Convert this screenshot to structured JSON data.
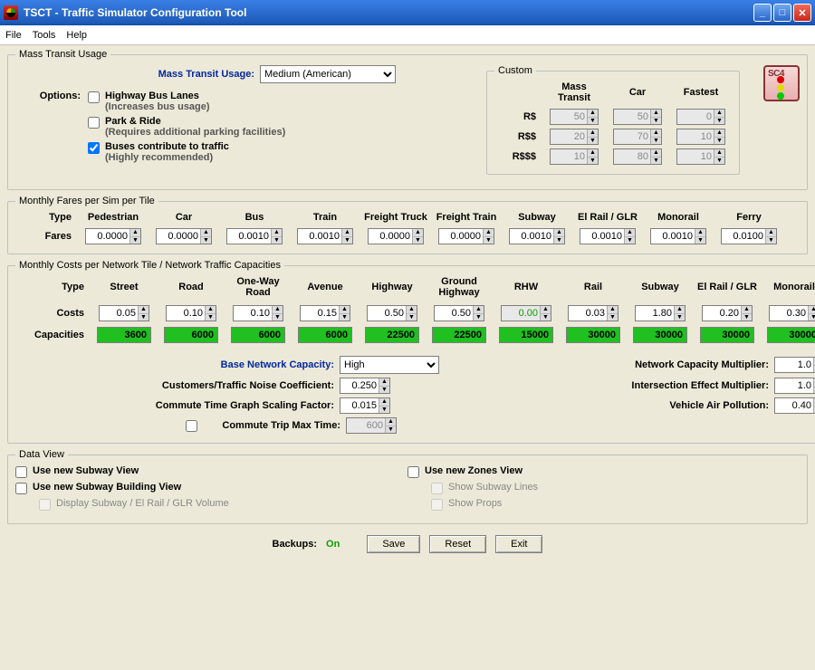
{
  "window_title": "TSCT - Traffic Simulator Configuration Tool",
  "menu": {
    "file": "File",
    "tools": "Tools",
    "help": "Help"
  },
  "mtu": {
    "legend": "Mass Transit Usage",
    "label": "Mass Transit Usage:",
    "value": "Medium (American)",
    "options_label": "Options:",
    "opt1_label": "Highway Bus Lanes",
    "opt1_hint": "(Increases bus usage)",
    "opt2_label": "Park & Ride",
    "opt2_hint": "(Requires additional parking facilities)",
    "opt3_label": "Buses contribute to traffic",
    "opt3_hint": "(Highly recommended)",
    "opt3_checked": true,
    "custom": {
      "legend": "Custom",
      "h_mt": "Mass Transit",
      "h_car": "Car",
      "h_fast": "Fastest",
      "r1": "R$",
      "r1_mt": "50",
      "r1_car": "50",
      "r1_fast": "0",
      "r2": "R$$",
      "r2_mt": "20",
      "r2_car": "70",
      "r2_fast": "10",
      "r3": "R$$$",
      "r3_mt": "10",
      "r3_car": "80",
      "r3_fast": "10"
    }
  },
  "fares": {
    "legend": "Monthly Fares per Sim per Tile",
    "type_label": "Type",
    "row_label": "Fares",
    "cols": [
      "Pedestrian",
      "Car",
      "Bus",
      "Train",
      "Freight Truck",
      "Freight Train",
      "Subway",
      "El Rail / GLR",
      "Monorail",
      "Ferry"
    ],
    "vals": [
      "0.0000",
      "0.0000",
      "0.0010",
      "0.0010",
      "0.0000",
      "0.0000",
      "0.0010",
      "0.0010",
      "0.0010",
      "0.0100"
    ]
  },
  "costs": {
    "legend": "Monthly Costs per Network Tile / Network Traffic Capacities",
    "type_label": "Type",
    "row_costs": "Costs",
    "row_caps": "Capacities",
    "cols": [
      "Street",
      "Road",
      "One-Way Road",
      "Avenue",
      "Highway",
      "Ground Highway",
      "RHW",
      "Rail",
      "Subway",
      "El Rail / GLR",
      "Monorail"
    ],
    "cost_vals": [
      "0.05",
      "0.10",
      "0.10",
      "0.15",
      "0.50",
      "0.50",
      "0.00",
      "0.03",
      "1.80",
      "0.20",
      "0.30"
    ],
    "cap_vals": [
      "3600",
      "6000",
      "6000",
      "6000",
      "22500",
      "22500",
      "15000",
      "30000",
      "30000",
      "30000",
      "30000"
    ],
    "bnc_label": "Base Network Capacity:",
    "bnc_value": "High",
    "ctnc_label": "Customers/Traffic Noise Coefficient:",
    "ctnc_val": "0.250",
    "ctsf_label": "Commute Time Graph Scaling Factor:",
    "ctsf_val": "0.015",
    "ctmt_label": "Commute Trip Max Time:",
    "ctmt_val": "600",
    "ncm_label": "Network Capacity Multiplier:",
    "ncm_val": "1.0",
    "iem_label": "Intersection Effect Multiplier:",
    "iem_val": "1.0",
    "vap_label": "Vehicle Air Pollution:",
    "vap_val": "0.40"
  },
  "dataview": {
    "legend": "Data View",
    "sv": "Use new Subway View",
    "sbv": "Use new Subway Building View",
    "dser": "Display Subway / El Rail / GLR Volume",
    "zv": "Use new Zones View",
    "ssl": "Show Subway Lines",
    "sp": "Show Props"
  },
  "bottom": {
    "backups_label": "Backups:",
    "backups_state": "On",
    "save": "Save",
    "reset": "Reset",
    "exit": "Exit"
  }
}
